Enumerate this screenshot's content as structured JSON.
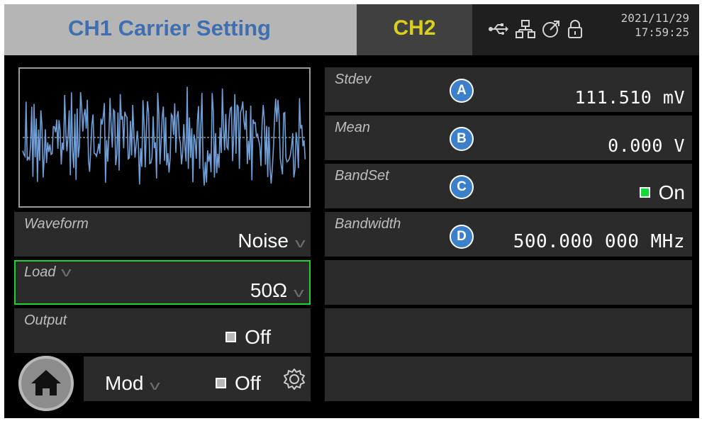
{
  "header": {
    "title": "CH1 Carrier Setting",
    "ch2_label": "CH2",
    "date": "2021/11/29",
    "time": "17:59:25",
    "icons": [
      "usb-icon",
      "network-icon",
      "external-clock-icon",
      "lock-icon"
    ]
  },
  "left": {
    "waveform": {
      "label": "Waveform",
      "value": "Noise"
    },
    "load": {
      "label": "Load",
      "value": "50Ω"
    },
    "output": {
      "label": "Output",
      "value": "Off"
    },
    "mod": {
      "label": "Mod",
      "value": "Off"
    }
  },
  "right": {
    "stdev": {
      "label": "Stdev",
      "badge": "A",
      "value": "111.510 mV"
    },
    "mean": {
      "label": "Mean",
      "badge": "B",
      "value": "0.000 V"
    },
    "bandset": {
      "label": "BandSet",
      "badge": "C",
      "value": "On"
    },
    "bandwidth": {
      "label": "Bandwidth",
      "badge": "D",
      "value": "500.000 000 MHz"
    }
  },
  "colors": {
    "title_blue": "#3f6fb0",
    "ch2_yellow": "#d9cf1c",
    "selected_border": "#1bd52e",
    "badge_blue": "#3c80cc",
    "wave_blue": "#6f9fd8"
  }
}
